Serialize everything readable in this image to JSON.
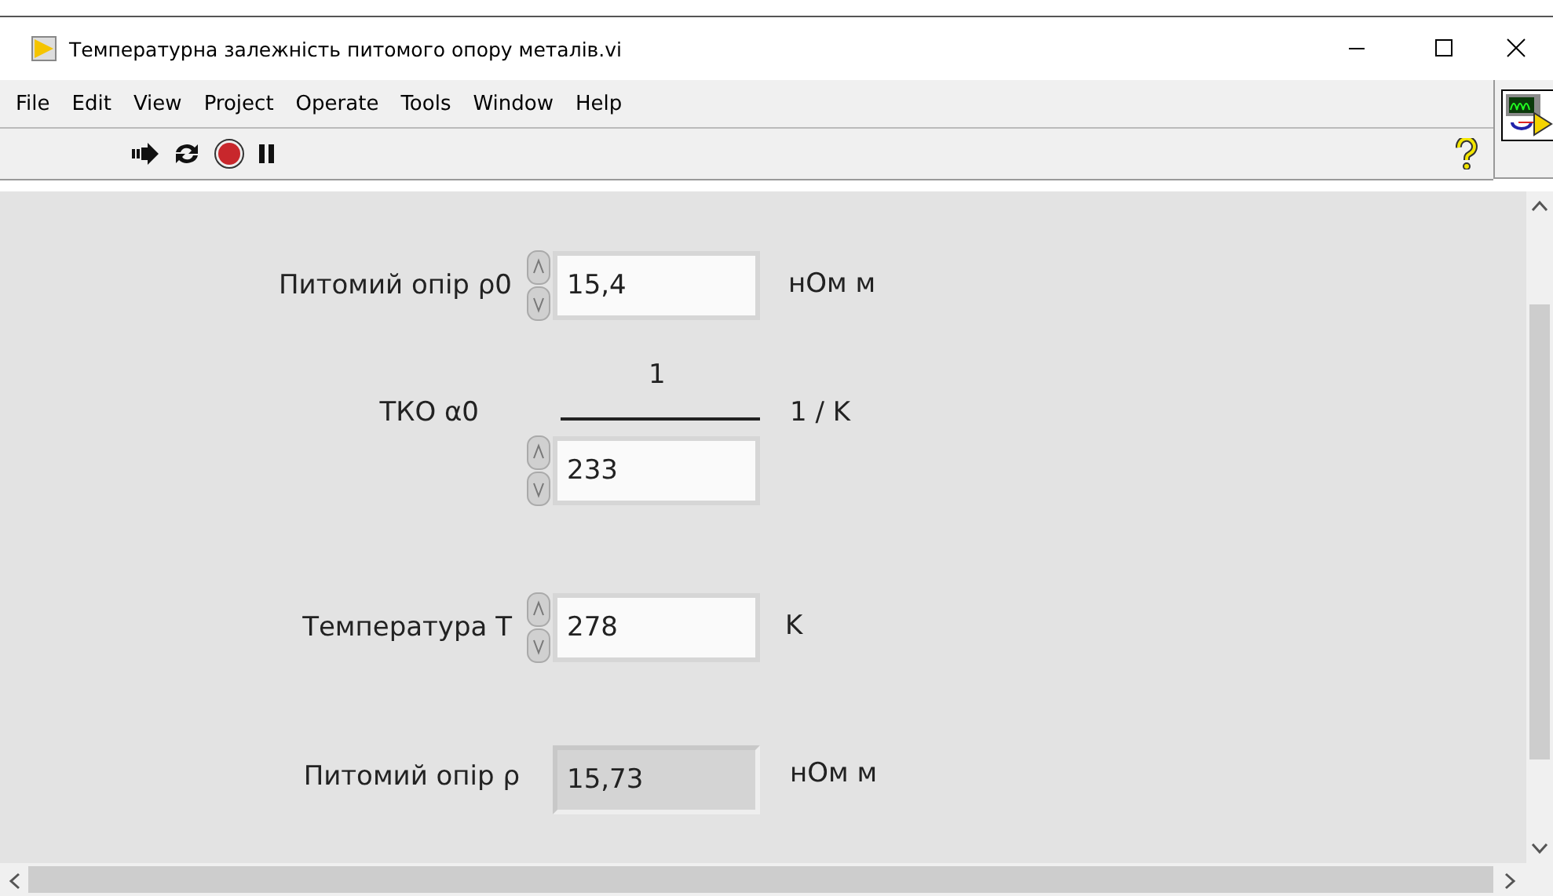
{
  "window": {
    "title": "Температурна залежність питомого опору металів.vi"
  },
  "menu": [
    "File",
    "Edit",
    "View",
    "Project",
    "Operate",
    "Tools",
    "Window",
    "Help"
  ],
  "controls": [
    {
      "kind": "numeric",
      "label": "Питомий опір ρ0",
      "value": "15,4",
      "unit": "нОм м"
    },
    {
      "kind": "fraction",
      "label": "ТКО α0",
      "numerator": "1",
      "value": "233",
      "unit": "1 / K"
    },
    {
      "kind": "numeric",
      "label": "Температура T",
      "value": "278",
      "unit": "K"
    },
    {
      "kind": "indicator",
      "label": "Питомий опір ρ",
      "value": "15,73",
      "unit": "нОм м"
    }
  ]
}
